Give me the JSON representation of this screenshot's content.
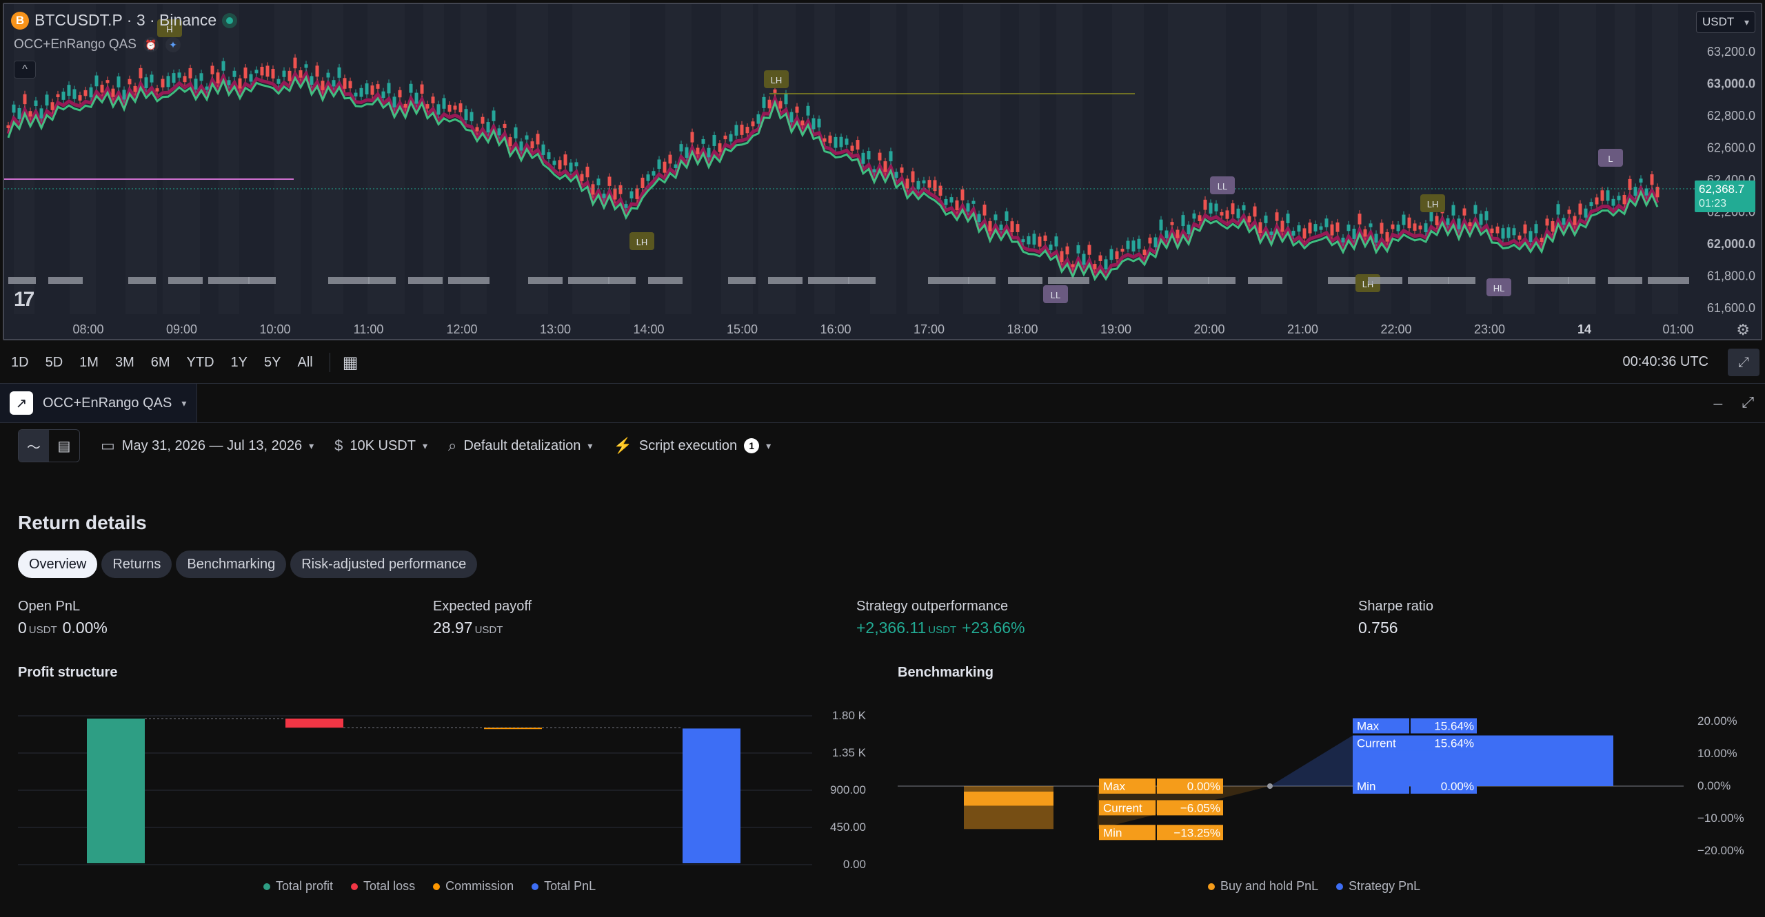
{
  "symbol": {
    "name": "BTCUSDT.P · 3 · Binance",
    "coin_icon": "B"
  },
  "indicator": {
    "name": "OCC+EnRango QAS"
  },
  "currency_selector": "USDT",
  "price_axis": [
    "63,200.0",
    "63,000.0",
    "62,800.0",
    "62,600.0",
    "62,400.0",
    "62,200.0",
    "62,000.0",
    "61,800.0",
    "61,600.0"
  ],
  "current_price": {
    "value": "62,368.7",
    "countdown": "01:23"
  },
  "time_axis": [
    "08:00",
    "09:00",
    "10:00",
    "11:00",
    "12:00",
    "13:00",
    "14:00",
    "15:00",
    "16:00",
    "17:00",
    "18:00",
    "19:00",
    "20:00",
    "21:00",
    "22:00",
    "23:00",
    "14",
    "01:00"
  ],
  "pivot_labels": [
    "LH",
    "LH",
    "LL",
    "LL",
    "LH",
    "LH",
    "HL",
    "L",
    "H"
  ],
  "timeframes": [
    "1D",
    "5D",
    "1M",
    "3M",
    "6M",
    "YTD",
    "1Y",
    "5Y",
    "All"
  ],
  "clock": "00:40:36 UTC",
  "panel": {
    "tab_label": "OCC+EnRango QAS",
    "date_range": "May 31, 2026 — Jul 13, 2026",
    "capital": "10K USDT",
    "detalization": "Default detalization",
    "script_execution": "Script execution",
    "script_badge": "1",
    "title": "Return details",
    "tabs": [
      "Overview",
      "Returns",
      "Benchmarking",
      "Risk-adjusted performance"
    ],
    "metrics": {
      "open_pnl": {
        "label": "Open PnL",
        "value": "0",
        "unit": "USDT",
        "pct": "0.00%"
      },
      "expected_payoff": {
        "label": "Expected payoff",
        "value": "28.97",
        "unit": "USDT"
      },
      "outperformance": {
        "label": "Strategy outperformance",
        "value": "+2,366.11",
        "unit": "USDT",
        "pct": "+23.66%"
      },
      "sharpe": {
        "label": "Sharpe ratio",
        "value": "0.756"
      }
    },
    "profit_structure_title": "Profit structure",
    "benchmarking_title": "Benchmarking"
  },
  "chart_data": [
    {
      "type": "bar",
      "title": "Profit structure",
      "categories": [
        "Total profit",
        "Total loss",
        "Commission",
        "Total PnL"
      ],
      "y_ticks": [
        "1.80 K",
        "1.35 K",
        "900.00",
        "450.00",
        "0.00"
      ],
      "ylim": [
        0,
        1800
      ],
      "values": [
        1750,
        -110,
        -10,
        1630
      ],
      "colors": [
        "#2e9e84",
        "#f23645",
        "#ff9800",
        "#3d6ef5"
      ],
      "legend": [
        "Total profit",
        "Total loss",
        "Commission",
        "Total PnL"
      ]
    },
    {
      "type": "bar",
      "title": "Benchmarking",
      "y_ticks": [
        "20.00%",
        "10.00%",
        "0.00%",
        "−10.00%",
        "−20.00%"
      ],
      "ylim": [
        -20,
        20
      ],
      "series": [
        {
          "name": "Buy and hold PnL",
          "color": "#f59c1a",
          "max": "0.00%",
          "current": "−6.05%",
          "min": "−13.25%",
          "max_v": 0,
          "current_v": -6.05,
          "min_v": -13.25
        },
        {
          "name": "Strategy PnL",
          "color": "#3d6ef5",
          "max": "15.64%",
          "current": "15.64%",
          "min": "0.00%",
          "max_v": 15.64,
          "current_v": 15.64,
          "min_v": 0
        }
      ],
      "labels": {
        "max": "Max",
        "current": "Current",
        "min": "Min"
      },
      "legend": [
        "Buy and hold PnL",
        "Strategy PnL"
      ]
    }
  ]
}
